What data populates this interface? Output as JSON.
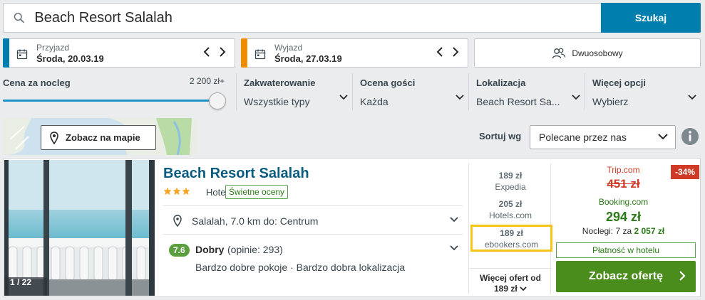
{
  "search": {
    "value": "Beach Resort Salalah",
    "button_label": "Szukaj"
  },
  "dates": {
    "checkin": {
      "label": "Przyjazd",
      "value": "Środa, 20.03.19",
      "stripe_color": "#007faf"
    },
    "checkout": {
      "label": "Wyjazd",
      "value": "Środa, 27.03.19",
      "stripe_color": "#f08c00"
    }
  },
  "guests": {
    "label": "Dwuosobowy"
  },
  "filters": {
    "price": {
      "label": "Cena za nocleg",
      "value": "2 200 zł+",
      "level": 1.0
    },
    "accommodation": {
      "label": "Zakwaterowanie",
      "value": "Wszystkie typy"
    },
    "guest_rating": {
      "label": "Ocena gości",
      "value": "Każda"
    },
    "location": {
      "label": "Lokalizacja",
      "value": "Beach Resort Sa..."
    },
    "more": {
      "label": "Więcej opcji",
      "value": "Wybierz"
    }
  },
  "map": {
    "button_label": "Zobacz na mapie"
  },
  "sort": {
    "label": "Sortuj wg",
    "value": "Polecane przez nas"
  },
  "hotel": {
    "name": "Beach Resort Salalah",
    "stars": 3,
    "type": "Hotel",
    "badge": "Świetne oceny",
    "photo_count": "1 / 22",
    "location": "Salalah, 7.0 km do: Centrum",
    "rating_score": "7.6",
    "rating_word": "Dobry",
    "rating_count": "(opinie: 293)",
    "rating_notes": "Bardzo dobre pokoje · Bardzo dobra lokalizacja"
  },
  "offers": [
    {
      "price": "189 zł",
      "site": "Expedia"
    },
    {
      "price": "205 zł",
      "site": "Hotels.com"
    },
    {
      "price": "189 zł",
      "site": "ebookers.com"
    }
  ],
  "more_offers": {
    "line1": "Więcej ofert od",
    "line2": "189 zł"
  },
  "deal": {
    "discount": "-34%",
    "old_source": "Trip.com",
    "old_price": "451 zł",
    "source": "Booking.com",
    "price": "294 zł",
    "nights_prefix": "Noclegi: 7 za",
    "nights_total": "2 057 zł",
    "pay_note": "Płatność w hotelu",
    "cta_label": "Zobacz ofertę"
  },
  "colors": {
    "brand_blue": "#007faf",
    "highlight": "#f7c418",
    "deal_green": "#4a8d1c",
    "discount_red": "#d03b28"
  }
}
